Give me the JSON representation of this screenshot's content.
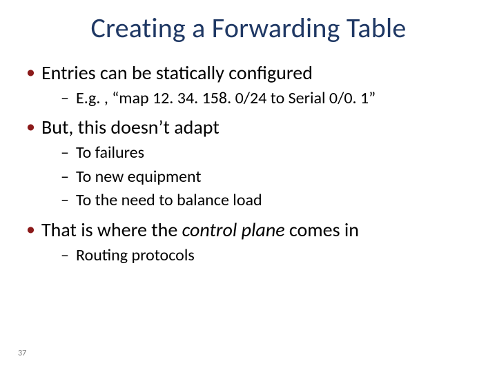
{
  "slide": {
    "title": "Creating a Forwarding Table",
    "bullets": [
      {
        "text": "Entries can be statically configured",
        "sub": [
          "E.g. , “map 12. 34. 158. 0/24 to Serial 0/0. 1”"
        ]
      },
      {
        "text": "But, this doesn’t adapt",
        "sub": [
          "To failures",
          "To new equipment",
          "To the need to balance load"
        ]
      },
      {
        "text_pre": "That is where the ",
        "text_em": "control plane",
        "text_post": " comes in",
        "sub": [
          "Routing protocols"
        ]
      }
    ],
    "page_number": "37"
  }
}
